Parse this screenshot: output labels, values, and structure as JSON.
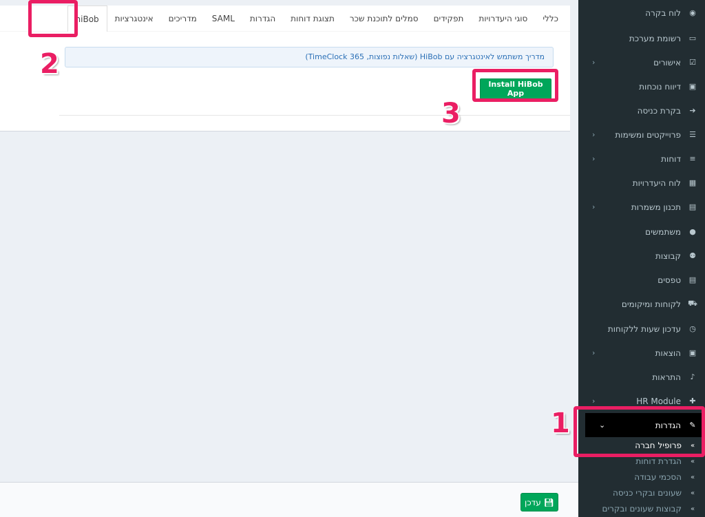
{
  "tabs": [
    {
      "label": "כללי"
    },
    {
      "label": "סוגי היעדרויות"
    },
    {
      "label": "תפקידים"
    },
    {
      "label": "סמלים לתוכנת שכר"
    },
    {
      "label": "תצוגת דוחות"
    },
    {
      "label": "הגדרות"
    },
    {
      "label": "SAML"
    },
    {
      "label": "מדריכים"
    },
    {
      "label": "אינטגרציות"
    },
    {
      "label": "hiBob"
    }
  ],
  "active_tab": "hiBob",
  "info_text": "מדריך משתמש לאינטגרציה עם HiBob (שאלות נפוצות, TimeClock 365)",
  "install_button": "Install HiBob App",
  "update_button": "עדכן",
  "sidebar": {
    "items": [
      {
        "label": "לוח בקרה",
        "icon": "dashboard-icon",
        "glyph": "◉",
        "chevron": false
      },
      {
        "label": "רשומת מערכת",
        "icon": "inbox-icon",
        "glyph": "▭",
        "chevron": false
      },
      {
        "label": "אישורים",
        "icon": "check-square-icon",
        "glyph": "☑",
        "chevron": true
      },
      {
        "label": "דיווח נוכחות",
        "icon": "calendar-icon",
        "glyph": "▣",
        "chevron": false
      },
      {
        "label": "בקרת כניסה",
        "icon": "sign-in-icon",
        "glyph": "➔",
        "chevron": false
      },
      {
        "label": "פרוייקטים ומשימות",
        "icon": "tasks-icon",
        "glyph": "☰",
        "chevron": true
      },
      {
        "label": "דוחות",
        "icon": "list-icon",
        "glyph": "≡",
        "chevron": true
      },
      {
        "label": "לוח היעדרויות",
        "icon": "calendar-grid-icon",
        "glyph": "▦",
        "chevron": false
      },
      {
        "label": "תכנון משמרות",
        "icon": "table-icon",
        "glyph": "▤",
        "chevron": true
      },
      {
        "label": "משתמשים",
        "icon": "user-icon",
        "glyph": "●",
        "chevron": false
      },
      {
        "label": "קבוצות",
        "icon": "users-icon",
        "glyph": "⚉",
        "chevron": false
      },
      {
        "label": "טפסים",
        "icon": "file-icon",
        "glyph": "▤",
        "chevron": false
      },
      {
        "label": "לקוחות ומיקומים",
        "icon": "cart-icon",
        "glyph": "⛟",
        "chevron": false
      },
      {
        "label": "עדכון שעות ללקוחות",
        "icon": "clock-icon",
        "glyph": "◷",
        "chevron": false
      },
      {
        "label": "הוצאות",
        "icon": "money-icon",
        "glyph": "▣",
        "chevron": true
      },
      {
        "label": "התראות",
        "icon": "bell-icon",
        "glyph": "♪",
        "chevron": false
      },
      {
        "label": "HR Module",
        "icon": "user-plus-icon",
        "glyph": "✚",
        "chevron": true
      },
      {
        "label": "הגדרות",
        "icon": "wrench-icon",
        "glyph": "✎",
        "chevron": true,
        "active": true
      }
    ],
    "subitems": [
      {
        "label": "פרופיל חברה",
        "current": true
      },
      {
        "label": "הגדרת דוחות"
      },
      {
        "label": "הסכמי עבודה"
      },
      {
        "label": "שעונים ובקרי כניסה"
      },
      {
        "label": "קבוצות שעונים ובקרים"
      }
    ]
  },
  "annotations": [
    {
      "number": "1",
      "target": "settings-menu"
    },
    {
      "number": "2",
      "target": "hibob-tab"
    },
    {
      "number": "3",
      "target": "install-button"
    }
  ],
  "colors": {
    "sidebar_bg": "#222d32",
    "accent_green": "#00a65a",
    "annotation": "#ea1e63",
    "info_bg": "#eef4fb",
    "info_text": "#2a6fb6"
  }
}
